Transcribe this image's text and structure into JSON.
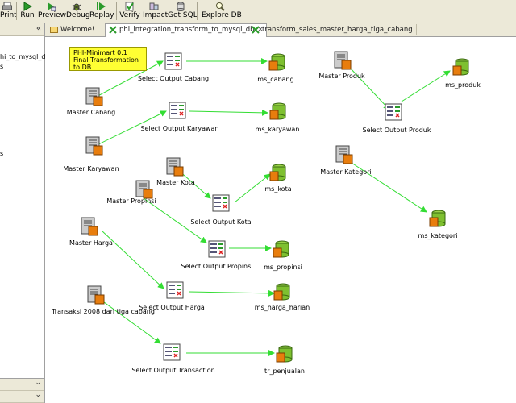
{
  "toolbar": {
    "buttons": [
      {
        "label": "Print",
        "icon": "printer-icon"
      },
      {
        "label": "Run",
        "icon": "run-icon"
      },
      {
        "label": "Preview",
        "icon": "preview-icon"
      },
      {
        "label": "Debug",
        "icon": "debug-icon"
      },
      {
        "label": "Replay",
        "icon": "replay-icon"
      },
      {
        "label": "Verify",
        "icon": "verify-icon"
      },
      {
        "label": "Impact",
        "icon": "impact-icon"
      },
      {
        "label": "Get SQL",
        "icon": "sql-icon"
      },
      {
        "label": "Explore DB",
        "icon": "explore-db-icon"
      }
    ]
  },
  "left_panel": {
    "items": [
      "hi_to_mysql_db",
      "s",
      "s"
    ]
  },
  "tabs": [
    {
      "label": "Welcome!",
      "icon": "welcome-icon"
    },
    {
      "label": "phi_integration_transform_to_mysql_db",
      "icon": "transformation-icon",
      "close": "✕"
    },
    {
      "label": "transform_sales_master_harga_tiga_cabang",
      "icon": "transformation-icon"
    }
  ],
  "note": {
    "line1": "PHI-Minimart 0.1",
    "line2": "Final Transformation to DB"
  },
  "steps": {
    "master_cabang": "Master Cabang",
    "select_output_cabang": "Select Output Cabang",
    "ms_cabang": "ms_cabang",
    "master_karyawan": "Master Karyawan",
    "select_output_karyawan": "Select Output Karyawan",
    "ms_karyawan": "ms_karyawan",
    "master_kota": "Master Kota",
    "select_output_kota": "Select Output Kota",
    "ms_kota": "ms_kota",
    "master_propinsi": "Master Propinsi",
    "select_output_propinsi": "Select Output Propinsi",
    "ms_propinsi": "ms_propinsi",
    "master_harga": "Master Harga",
    "select_output_harga": "Select Output Harga",
    "ms_harga_harian": "ms_harga_harian",
    "transaksi": "Transaksi 2008 dari tiga cabang",
    "select_output_transaction": "Select Output Transaction",
    "tr_penjualan": "tr_penjualan",
    "master_produk": "Master Produk",
    "select_output_produk": "Select Output Produk",
    "ms_produk": "ms_produk",
    "master_kategori": "Master Kategori",
    "ms_kategori": "ms_kategori"
  },
  "colors": {
    "hop": "#33dd33",
    "note": "#ffff33",
    "toolbar_bg": "#ece9d8"
  }
}
